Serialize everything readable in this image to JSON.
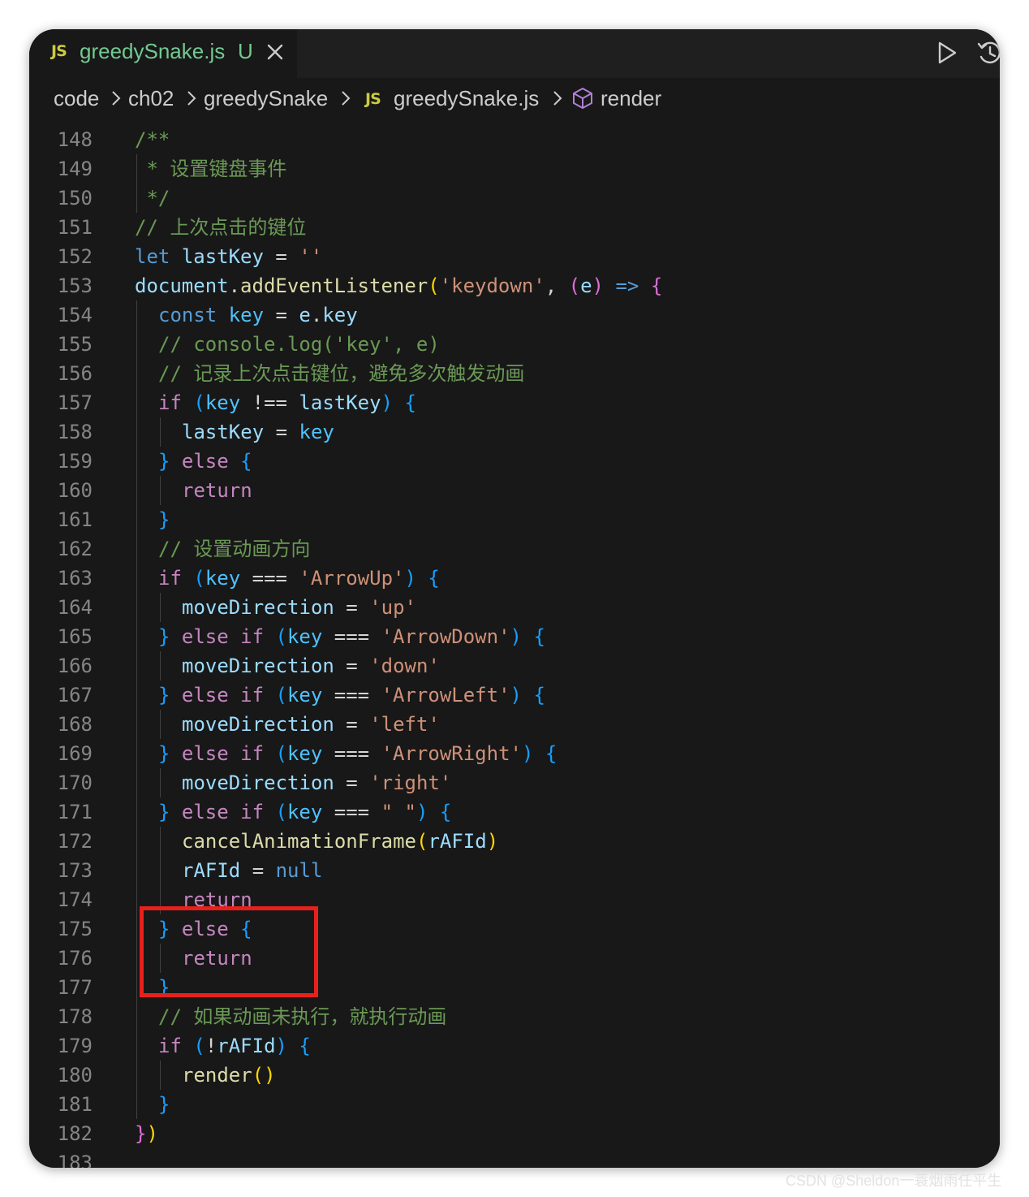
{
  "tab": {
    "icon": "JS",
    "filename": "greedySnake.js",
    "status": "U"
  },
  "toolbar": {
    "run_icon": "play-icon",
    "history_icon": "history-icon"
  },
  "breadcrumb": {
    "items": [
      "code",
      "ch02",
      "greedySnake",
      "greedySnake.js",
      "render"
    ],
    "file_icon": "JS",
    "symbol_icon": "cube-icon"
  },
  "code_lines": [
    {
      "n": "148",
      "indent": 0,
      "tokens": [
        [
          "cm",
          "/**"
        ]
      ]
    },
    {
      "n": "149",
      "indent": 0,
      "tokens": [
        [
          "cm",
          " * 设置键盘事件"
        ]
      ]
    },
    {
      "n": "150",
      "indent": 0,
      "tokens": [
        [
          "cm",
          " */"
        ]
      ]
    },
    {
      "n": "151",
      "indent": 0,
      "tokens": [
        [
          "cm",
          "// 上次点击的键位"
        ]
      ]
    },
    {
      "n": "152",
      "indent": 0,
      "tokens": [
        [
          "kw",
          "let"
        ],
        [
          "pl",
          " "
        ],
        [
          "var",
          "lastKey"
        ],
        [
          "pl",
          " = "
        ],
        [
          "str",
          "''"
        ]
      ]
    },
    {
      "n": "153",
      "indent": 0,
      "tokens": [
        [
          "var",
          "document"
        ],
        [
          "pl",
          "."
        ],
        [
          "fn",
          "addEventListener"
        ],
        [
          "b1",
          "("
        ],
        [
          "str",
          "'keydown'"
        ],
        [
          "pl",
          ", "
        ],
        [
          "b2",
          "("
        ],
        [
          "var",
          "e"
        ],
        [
          "b2",
          ")"
        ],
        [
          "pl",
          " "
        ],
        [
          "kw",
          "=>"
        ],
        [
          "pl",
          " "
        ],
        [
          "b2",
          "{"
        ]
      ]
    },
    {
      "n": "154",
      "indent": 1,
      "tokens": [
        [
          "kw",
          "const"
        ],
        [
          "pl",
          " "
        ],
        [
          "const",
          "key"
        ],
        [
          "pl",
          " = "
        ],
        [
          "var",
          "e"
        ],
        [
          "pl",
          "."
        ],
        [
          "var",
          "key"
        ]
      ]
    },
    {
      "n": "155",
      "indent": 1,
      "tokens": [
        [
          "cm",
          "// console.log('key', e)"
        ]
      ]
    },
    {
      "n": "156",
      "indent": 1,
      "tokens": [
        [
          "cm",
          "// 记录上次点击键位，避免多次触发动画"
        ]
      ]
    },
    {
      "n": "157",
      "indent": 1,
      "tokens": [
        [
          "ctl",
          "if"
        ],
        [
          "pl",
          " "
        ],
        [
          "b3",
          "("
        ],
        [
          "const",
          "key"
        ],
        [
          "pl",
          " !== "
        ],
        [
          "var",
          "lastKey"
        ],
        [
          "b3",
          ")"
        ],
        [
          "pl",
          " "
        ],
        [
          "b3",
          "{"
        ]
      ]
    },
    {
      "n": "158",
      "indent": 2,
      "tokens": [
        [
          "var",
          "lastKey"
        ],
        [
          "pl",
          " = "
        ],
        [
          "const",
          "key"
        ]
      ]
    },
    {
      "n": "159",
      "indent": 1,
      "tokens": [
        [
          "b3",
          "}"
        ],
        [
          "pl",
          " "
        ],
        [
          "ctl",
          "else"
        ],
        [
          "pl",
          " "
        ],
        [
          "b3",
          "{"
        ]
      ]
    },
    {
      "n": "160",
      "indent": 2,
      "tokens": [
        [
          "ctl",
          "return"
        ]
      ]
    },
    {
      "n": "161",
      "indent": 1,
      "tokens": [
        [
          "b3",
          "}"
        ]
      ]
    },
    {
      "n": "162",
      "indent": 1,
      "tokens": [
        [
          "cm",
          "// 设置动画方向"
        ]
      ]
    },
    {
      "n": "163",
      "indent": 1,
      "tokens": [
        [
          "ctl",
          "if"
        ],
        [
          "pl",
          " "
        ],
        [
          "b3",
          "("
        ],
        [
          "const",
          "key"
        ],
        [
          "pl",
          " === "
        ],
        [
          "str",
          "'ArrowUp'"
        ],
        [
          "b3",
          ")"
        ],
        [
          "pl",
          " "
        ],
        [
          "b3",
          "{"
        ]
      ]
    },
    {
      "n": "164",
      "indent": 2,
      "tokens": [
        [
          "var",
          "moveDirection"
        ],
        [
          "pl",
          " = "
        ],
        [
          "str",
          "'up'"
        ]
      ]
    },
    {
      "n": "165",
      "indent": 1,
      "tokens": [
        [
          "b3",
          "}"
        ],
        [
          "pl",
          " "
        ],
        [
          "ctl",
          "else if"
        ],
        [
          "pl",
          " "
        ],
        [
          "b3",
          "("
        ],
        [
          "const",
          "key"
        ],
        [
          "pl",
          " === "
        ],
        [
          "str",
          "'ArrowDown'"
        ],
        [
          "b3",
          ")"
        ],
        [
          "pl",
          " "
        ],
        [
          "b3",
          "{"
        ]
      ]
    },
    {
      "n": "166",
      "indent": 2,
      "tokens": [
        [
          "var",
          "moveDirection"
        ],
        [
          "pl",
          " = "
        ],
        [
          "str",
          "'down'"
        ]
      ]
    },
    {
      "n": "167",
      "indent": 1,
      "tokens": [
        [
          "b3",
          "}"
        ],
        [
          "pl",
          " "
        ],
        [
          "ctl",
          "else if"
        ],
        [
          "pl",
          " "
        ],
        [
          "b3",
          "("
        ],
        [
          "const",
          "key"
        ],
        [
          "pl",
          " === "
        ],
        [
          "str",
          "'ArrowLeft'"
        ],
        [
          "b3",
          ")"
        ],
        [
          "pl",
          " "
        ],
        [
          "b3",
          "{"
        ]
      ]
    },
    {
      "n": "168",
      "indent": 2,
      "tokens": [
        [
          "var",
          "moveDirection"
        ],
        [
          "pl",
          " = "
        ],
        [
          "str",
          "'left'"
        ]
      ]
    },
    {
      "n": "169",
      "indent": 1,
      "tokens": [
        [
          "b3",
          "}"
        ],
        [
          "pl",
          " "
        ],
        [
          "ctl",
          "else if"
        ],
        [
          "pl",
          " "
        ],
        [
          "b3",
          "("
        ],
        [
          "const",
          "key"
        ],
        [
          "pl",
          " === "
        ],
        [
          "str",
          "'ArrowRight'"
        ],
        [
          "b3",
          ")"
        ],
        [
          "pl",
          " "
        ],
        [
          "b3",
          "{"
        ]
      ]
    },
    {
      "n": "170",
      "indent": 2,
      "tokens": [
        [
          "var",
          "moveDirection"
        ],
        [
          "pl",
          " = "
        ],
        [
          "str",
          "'right'"
        ]
      ]
    },
    {
      "n": "171",
      "indent": 1,
      "tokens": [
        [
          "b3",
          "}"
        ],
        [
          "pl",
          " "
        ],
        [
          "ctl",
          "else if"
        ],
        [
          "pl",
          " "
        ],
        [
          "b3",
          "("
        ],
        [
          "const",
          "key"
        ],
        [
          "pl",
          " === "
        ],
        [
          "str",
          "\" \""
        ],
        [
          "b3",
          ")"
        ],
        [
          "pl",
          " "
        ],
        [
          "b3",
          "{"
        ]
      ]
    },
    {
      "n": "172",
      "indent": 2,
      "tokens": [
        [
          "fn",
          "cancelAnimationFrame"
        ],
        [
          "b1",
          "("
        ],
        [
          "var",
          "rAFId"
        ],
        [
          "b1",
          ")"
        ]
      ]
    },
    {
      "n": "173",
      "indent": 2,
      "tokens": [
        [
          "var",
          "rAFId"
        ],
        [
          "pl",
          " = "
        ],
        [
          "kw",
          "null"
        ]
      ]
    },
    {
      "n": "174",
      "indent": 2,
      "tokens": [
        [
          "ctl",
          "return"
        ]
      ]
    },
    {
      "n": "175",
      "indent": 1,
      "tokens": [
        [
          "b3",
          "}"
        ],
        [
          "pl",
          " "
        ],
        [
          "ctl",
          "else"
        ],
        [
          "pl",
          " "
        ],
        [
          "b3",
          "{"
        ]
      ]
    },
    {
      "n": "176",
      "indent": 2,
      "tokens": [
        [
          "ctl",
          "return"
        ]
      ]
    },
    {
      "n": "177",
      "indent": 1,
      "tokens": [
        [
          "b3",
          "}"
        ]
      ]
    },
    {
      "n": "178",
      "indent": 1,
      "tokens": [
        [
          "cm",
          "// 如果动画未执行，就执行动画"
        ]
      ]
    },
    {
      "n": "179",
      "indent": 1,
      "tokens": [
        [
          "ctl",
          "if"
        ],
        [
          "pl",
          " "
        ],
        [
          "b3",
          "("
        ],
        [
          "pl",
          "!"
        ],
        [
          "var",
          "rAFId"
        ],
        [
          "b3",
          ")"
        ],
        [
          "pl",
          " "
        ],
        [
          "b3",
          "{"
        ]
      ]
    },
    {
      "n": "180",
      "indent": 2,
      "tokens": [
        [
          "fn",
          "render"
        ],
        [
          "b1",
          "()"
        ]
      ]
    },
    {
      "n": "181",
      "indent": 1,
      "tokens": [
        [
          "b3",
          "}"
        ]
      ]
    },
    {
      "n": "182",
      "indent": 0,
      "tokens": [
        [
          "b2",
          "}"
        ],
        [
          "b1",
          ")"
        ]
      ]
    },
    {
      "n": "183",
      "indent": 0,
      "tokens": []
    }
  ],
  "watermark": "CSDN @Sheldon一蓑烟雨任平生",
  "colors": {
    "editor_bg": "#181818",
    "tab_active_text": "#73c991",
    "highlight": "#e8201d",
    "keyword": "#569cd6",
    "control": "#c586c0",
    "string": "#ce9178",
    "comment": "#6a9955",
    "function": "#dcdcaa",
    "variable": "#9cdcfe"
  }
}
